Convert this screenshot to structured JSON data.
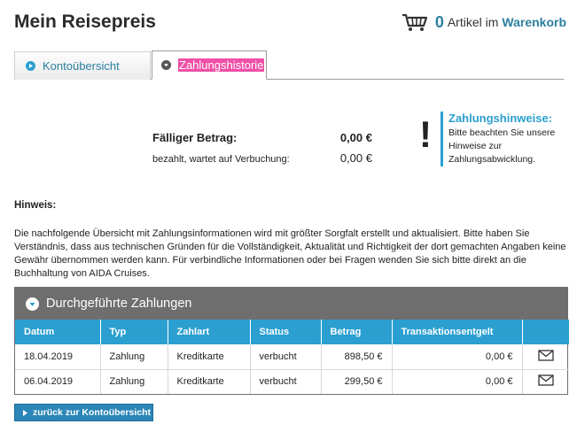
{
  "page": {
    "title": "Mein Reisepreis"
  },
  "cart": {
    "count": "0",
    "text": "Artikel im",
    "link": "Warenkorb"
  },
  "tabs": [
    {
      "label": "Kontoübersicht",
      "active": false
    },
    {
      "label": "Zahlungshistorie",
      "active": true
    }
  ],
  "due": {
    "label": "Fälliger Betrag:",
    "amount": "0,00 €",
    "pending_label": "bezahlt, wartet auf Verbuchung:",
    "pending_amount": "0,00 €"
  },
  "notice": {
    "mark": "!",
    "title": "Zahlungshinweise:",
    "body": "Bitte beachten Sie unsere Hinweise zur Zahlungsabwicklung."
  },
  "hint": {
    "title": "Hinweis:",
    "text": "Die nachfolgende Übersicht mit Zahlungsinformationen wird mit größter Sorgfalt erstellt und aktualisiert. Bitte haben Sie Verständnis, dass aus technischen Gründen für die Vollständigkeit, Aktualität und Richtigkeit der dort gemachten Angaben keine Gewähr übernommen werden kann. Für verbindliche Informationen oder bei Fragen wenden Sie sich bitte direkt an die Buchhaltung von AIDA Cruises."
  },
  "payments": {
    "title": "Durchgeführte Zahlungen",
    "columns": [
      "Datum",
      "Typ",
      "Zahlart",
      "Status",
      "Betrag",
      "Transaktionsentgelt",
      ""
    ],
    "rows": [
      [
        "18.04.2019",
        "Zahlung",
        "Kreditkarte",
        "verbucht",
        "898,50 €",
        "0,00 €"
      ],
      [
        "06.04.2019",
        "Zahlung",
        "Kreditkarte",
        "verbucht",
        "299,50 €",
        "0,00 €"
      ]
    ]
  },
  "back_button": {
    "label": "zurück zur Kontoübersicht"
  },
  "colors": {
    "accent": "#2b9fd0",
    "link": "#2b7fa0",
    "highlight": "#ef4fa6",
    "panel": "#6e6e6e"
  },
  "icons": [
    "cart-icon",
    "play-circle-icon",
    "chevron-down-circle-icon",
    "envelope-icon",
    "chevron-right-icon"
  ]
}
